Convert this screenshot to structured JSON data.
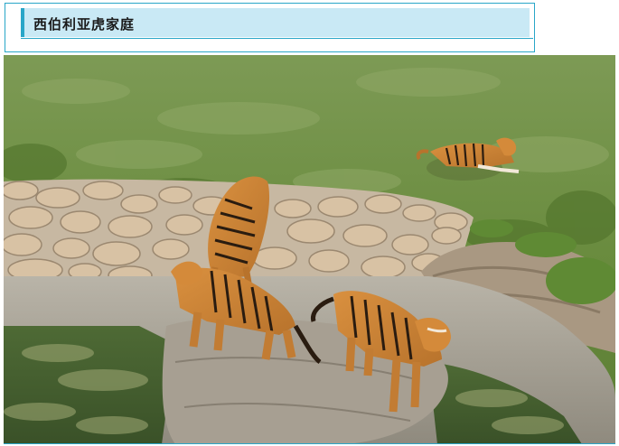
{
  "header": {
    "title": "西伯利亚虎家庭"
  },
  "photo": {
    "subject": "tiger-enclosure-photo",
    "colors": {
      "frame": "#29a6c8",
      "title_band": "#c9e9f5"
    }
  }
}
